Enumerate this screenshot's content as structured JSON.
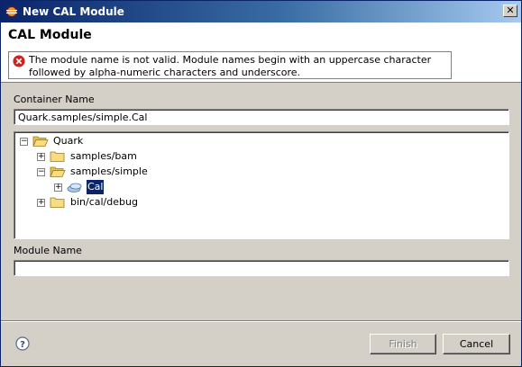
{
  "window": {
    "title": "New CAL Module",
    "close_glyph": "✕"
  },
  "header": {
    "title": "CAL Module",
    "message": "The module name is not valid. Module names begin with an uppercase character followed by alpha-numeric characters and underscore."
  },
  "container": {
    "label": "Container Name",
    "value": "Quark.samples/simple.Cal"
  },
  "tree": {
    "nodes": [
      {
        "label": "Quark",
        "icon": "folder-open-icon",
        "expander": "−"
      },
      {
        "label": "samples/bam",
        "icon": "folder-icon",
        "expander": "+"
      },
      {
        "label": "samples/simple",
        "icon": "folder-open-icon",
        "expander": "−"
      },
      {
        "label": "Cal",
        "icon": "package-icon",
        "expander": "+",
        "selected": true
      },
      {
        "label": "bin/cal/debug",
        "icon": "folder-icon",
        "expander": "+"
      }
    ]
  },
  "module": {
    "label": "Module Name",
    "value": ""
  },
  "buttons": {
    "finish": "Finish",
    "cancel": "Cancel"
  },
  "colors": {
    "accent": "#0a246a",
    "error": "#d02020",
    "folder": "#e8c050"
  }
}
